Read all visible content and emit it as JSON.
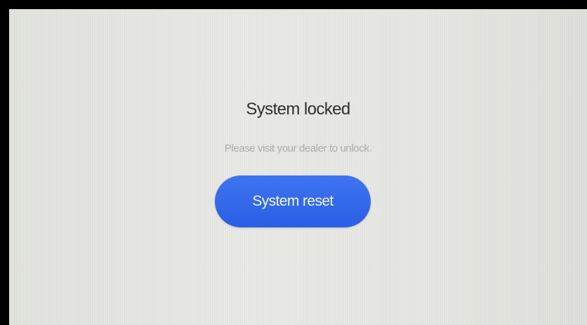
{
  "lock_screen": {
    "title": "System locked",
    "message": "Please visit your dealer to unlock.",
    "reset_button_label": "System reset"
  },
  "colors": {
    "accent": "#2f63e8",
    "background": "#e6e7e2",
    "title_text": "#2d302f",
    "message_text": "#a9aca9"
  }
}
